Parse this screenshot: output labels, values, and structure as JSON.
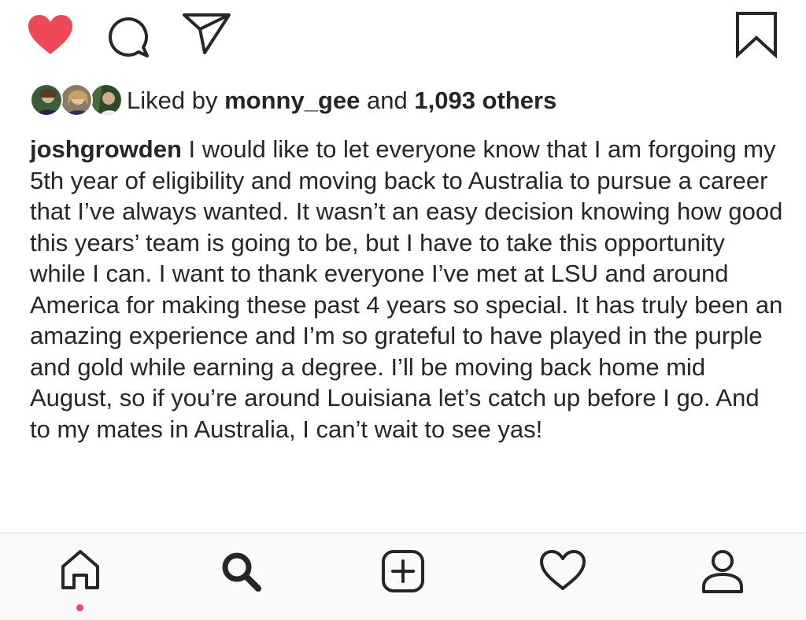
{
  "actions": {
    "like_icon": "heart-filled-icon",
    "comment_icon": "speech-bubble-icon",
    "share_icon": "paper-plane-icon",
    "save_icon": "bookmark-icon",
    "like_color": "#ed4956"
  },
  "likes": {
    "prefix": "Liked by",
    "user": "monny_gee",
    "connector": "and",
    "count": "1,093 others"
  },
  "caption": {
    "username": "joshgrowden",
    "text": "I would like to let everyone know that I am forgoing my 5th year of eligibility and moving back to Australia to pursue a career that I’ve always wanted. It wasn’t an easy decision knowing how good this years’ team is going to be, but I have to take this opportunity while I can. I want to thank everyone I’ve met at LSU and around America for making these past 4 years so special. It has truly been an amazing experience and I’m so grateful to have played in the purple and gold while earning a degree. I’ll be moving back home mid August, so if you’re around Louisiana let’s catch up before I go. And to my mates in Australia, I can’t wait to see yas!"
  },
  "tab_bar": {
    "items": [
      {
        "icon": "home-icon",
        "active": true
      },
      {
        "icon": "search-icon",
        "active": false
      },
      {
        "icon": "add-post-icon",
        "active": false
      },
      {
        "icon": "activity-heart-icon",
        "active": false
      },
      {
        "icon": "profile-icon",
        "active": false
      }
    ],
    "notification_color": "#ed4956"
  }
}
